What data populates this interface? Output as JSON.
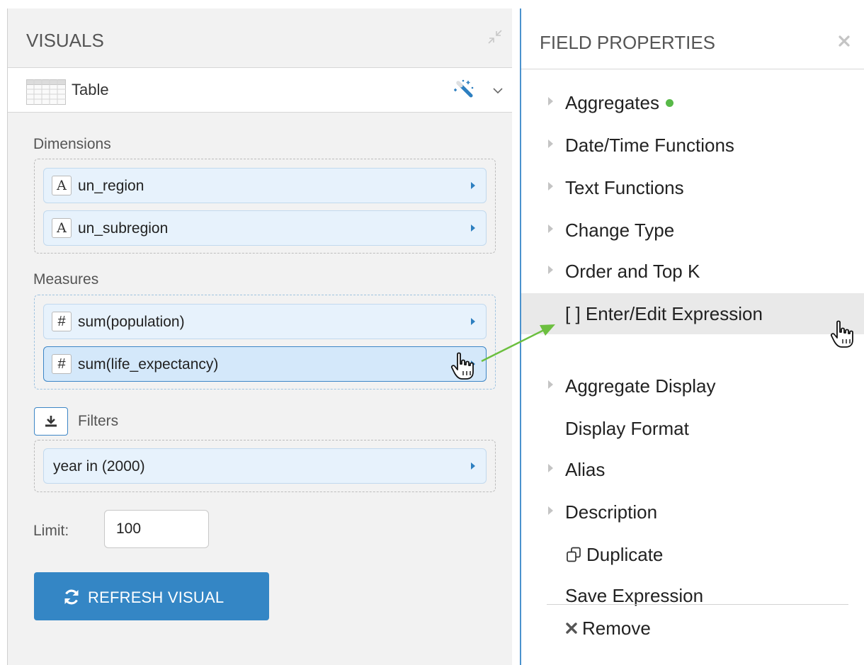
{
  "visuals_panel": {
    "title": "VISUALS",
    "visual_type": {
      "label": "Table"
    },
    "dimensions": {
      "label": "Dimensions",
      "fields": [
        {
          "type_icon": "A",
          "name": "un_region"
        },
        {
          "type_icon": "A",
          "name": "un_subregion"
        }
      ]
    },
    "measures": {
      "label": "Measures",
      "fields": [
        {
          "type_icon": "#",
          "name": "sum(population)"
        },
        {
          "type_icon": "#",
          "name": "sum(life_expectancy)"
        }
      ]
    },
    "filters": {
      "label": "Filters",
      "fields": [
        {
          "name": "year in (2000)"
        }
      ]
    },
    "limit": {
      "label": "Limit:",
      "value": "100"
    },
    "refresh_button": {
      "label": "REFRESH VISUAL"
    }
  },
  "field_properties": {
    "title": "FIELD PROPERTIES",
    "items": [
      {
        "label": "Aggregates"
      },
      {
        "label": "Date/Time Functions"
      },
      {
        "label": "Text Functions"
      },
      {
        "label": "Change Type"
      },
      {
        "label": "Order and Top K"
      },
      {
        "label": "[ ] Enter/Edit Expression"
      },
      {
        "label": "Aggregate Display"
      },
      {
        "label": "Display Format"
      },
      {
        "label": "Alias"
      },
      {
        "label": "Description"
      },
      {
        "label": "Duplicate"
      },
      {
        "label": "Save Expression"
      },
      {
        "label": "Remove"
      }
    ]
  },
  "colors": {
    "accent_blue": "#3486c5",
    "pill_background": "#e7f2fc",
    "status_green": "#58b948",
    "arrow_green": "#6cbf3f"
  }
}
